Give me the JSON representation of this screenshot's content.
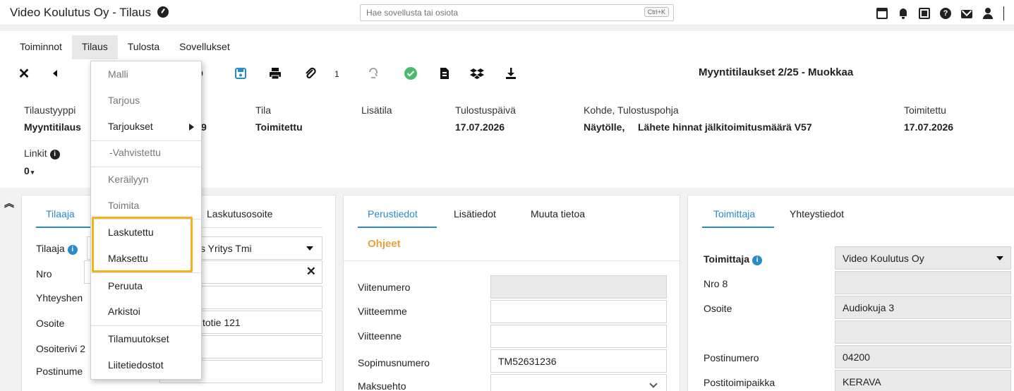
{
  "app": {
    "title": "Video Koulutus Oy - Tilaus",
    "search_placeholder": "Hae sovellusta tai osiota",
    "search_shortcut": "Ctrl+K"
  },
  "menubar": [
    "Toiminnot",
    "Tilaus",
    "Tulosta",
    "Sovellukset"
  ],
  "toolbar": {
    "attachment_count": "1"
  },
  "form_title": "Myyntitilaukset 2/25 - Muokkaa",
  "header_fields": {
    "tilaustyyppi_label": "Tilaustyyppi",
    "tilaustyyppi_value": "Myyntitilaus",
    "num_value": "9",
    "tila_label": "Tila",
    "tila_value": "Toimitettu",
    "lisatila_label": "Lisätila",
    "tulostuspaiva_label": "Tulostuspäivä",
    "tulostuspaiva_value": "17.07.2026",
    "kohde_label": "Kohde, Tulostuspohja",
    "kohde_value": "Näytölle,",
    "tulostuspohja_value": "Lähete hinnat jälkitoimitusmäärä V57",
    "toimitettu_label": "Toimitettu",
    "toimitettu_value": "17.07.2026",
    "linkit_label": "Linkit",
    "linkit_value": "0"
  },
  "dropdown_menu": {
    "items": [
      "Malli",
      "Tarjous",
      "Tarjoukset",
      "-Vahvistettu",
      "Keräilyyn",
      "Toimita",
      "Laskutettu",
      "Maksettu",
      "Peruuta",
      "Arkistoi",
      "Tilamuutokset",
      "Liitetiedostot"
    ],
    "highlighted": [
      "Laskutettu",
      "Maksettu"
    ]
  },
  "left_panel": {
    "tabs": [
      "Tilaaja",
      "Laskutusosoite"
    ],
    "labels": [
      "Tilaaja",
      "Nro",
      "Yhteyshen",
      "Osoite",
      "Osoiterivi 2",
      "Postinume"
    ],
    "tilaaja_value": "s Yritys Tmi",
    "osoite_value": "totie 121"
  },
  "middle_panel": {
    "tabs": [
      "Perustiedot",
      "Lisätiedot",
      "Muuta tietoa"
    ],
    "ohjeet": "Ohjeet",
    "labels": [
      "Viitenumero",
      "Viitteemme",
      "Viitteenne",
      "Sopimusnumero",
      "Maksuehto"
    ],
    "sopimusnumero_value": "TM52631236"
  },
  "right_panel": {
    "tabs": [
      "Toimittaja",
      "Yhteystiedot"
    ],
    "toimittaja_label": "Toimittaja",
    "toimittaja_value": "Video Koulutus Oy",
    "nro_label": "Nro 8",
    "osoite_label": "Osoite",
    "osoite_value": "Audiokuja 3",
    "postinumero_label": "Postinumero",
    "postinumero_value": "04200",
    "postitoimipaikka_label": "Postitoimipaikka",
    "postitoimipaikka_value": "KERAVA"
  },
  "colors": {
    "accent": "#2a8bc9",
    "ohjeet": "#e8a33d",
    "highlight": "#f2b418",
    "check": "#4cbb6c"
  },
  "icons": [
    "close-icon",
    "back-icon",
    "save-icon",
    "print-icon",
    "attachment-icon",
    "reply-icon",
    "check-icon",
    "document-icon",
    "dropbox-icon",
    "download-icon"
  ]
}
